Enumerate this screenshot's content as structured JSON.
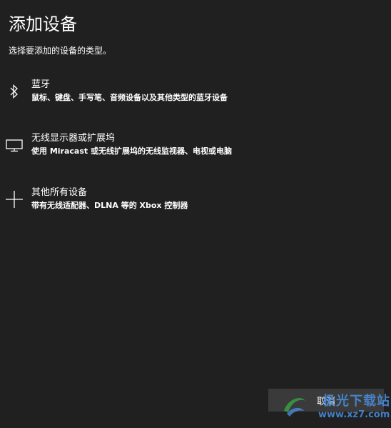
{
  "header": {
    "title": "添加设备",
    "subtitle": "选择要添加的设备的类型。"
  },
  "options": [
    {
      "icon": "bluetooth-icon",
      "title": "蓝牙",
      "description": "鼠标、键盘、手写笔、音频设备以及其他类型的蓝牙设备"
    },
    {
      "icon": "monitor-icon",
      "title": "无线显示器或扩展坞",
      "description": "使用 Miracast 或无线扩展坞的无线监视器、电视或电脑"
    },
    {
      "icon": "plus-icon",
      "title": "其他所有设备",
      "description": "带有无线适配器、DLNA 等的 Xbox 控制器"
    }
  ],
  "footer": {
    "cancel_label": "取消"
  },
  "watermark": {
    "text": "极光下载站",
    "url": "www.xz7.com"
  },
  "colors": {
    "background": "#202020",
    "text": "#ffffff",
    "button": "#3a3a3a",
    "watermark": "#4a8fe0"
  }
}
